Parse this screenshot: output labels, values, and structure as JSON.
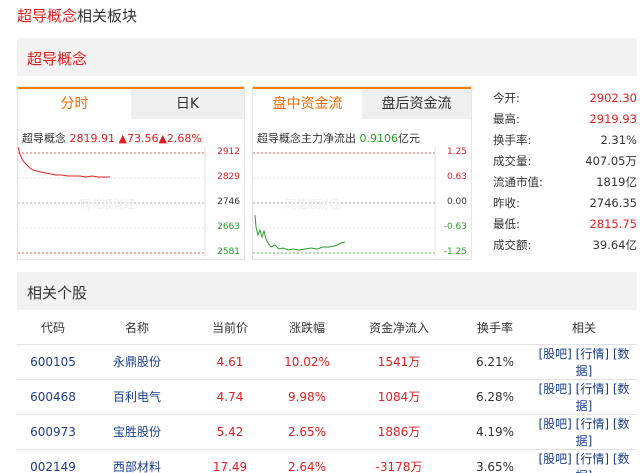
{
  "page_title": {
    "highlight": "超导概念",
    "suffix": "相关板块"
  },
  "board_name": "超导概念",
  "intraday_panel": {
    "tabs": [
      {
        "label": "分时",
        "active": true
      },
      {
        "label": "日K",
        "active": false
      }
    ],
    "caption_name": "超导概念",
    "caption_price": "2819.91",
    "caption_change": "▲73.56▲2.68%",
    "axis_labels": [
      "2912",
      "2829",
      "2746",
      "2663",
      "2581"
    ],
    "watermark": "同花顺财经",
    "line_color": "#e02020"
  },
  "flow_panel": {
    "tabs": [
      {
        "label": "盘中资金流",
        "active": true
      },
      {
        "label": "盘后资金流",
        "active": false
      }
    ],
    "caption_prefix": "超导概念主力净流出",
    "caption_value": "0.9106",
    "caption_unit": "亿元",
    "axis_labels": [
      "1.25",
      "0.63",
      "0.00",
      "-0.63",
      "-1.25"
    ],
    "watermark": "同花顺财经",
    "line_color": "#2a9d2a"
  },
  "stats": [
    {
      "label": "今开:",
      "value": "2902.30",
      "color": "red"
    },
    {
      "label": "最高:",
      "value": "2919.93",
      "color": "red"
    },
    {
      "label": "换手率:",
      "value": "2.31%",
      "color": "normal"
    },
    {
      "label": "成交量:",
      "value": "407.05万",
      "color": "normal"
    },
    {
      "label": "流通市值:",
      "value": "1819亿",
      "color": "normal"
    },
    {
      "label": "昨收:",
      "value": "2746.35",
      "color": "normal"
    },
    {
      "label": "最低:",
      "value": "2815.75",
      "color": "red"
    },
    {
      "label": "成交额:",
      "value": "39.64亿",
      "color": "normal"
    }
  ],
  "stocks_section_title": "相关个股",
  "table": {
    "headers": [
      "代码",
      "名称",
      "当前价",
      "涨跌幅",
      "资金净流入",
      "换手率",
      "相关"
    ],
    "rows": [
      {
        "code": "600105",
        "name": "永鼎股份",
        "price": "4.61",
        "change": "10.02%",
        "inflow": "1541万",
        "turnover": "6.21%"
      },
      {
        "code": "600468",
        "name": "百利电气",
        "price": "4.74",
        "change": "9.98%",
        "inflow": "1084万",
        "turnover": "6.28%"
      },
      {
        "code": "600973",
        "name": "宝胜股份",
        "price": "5.42",
        "change": "2.65%",
        "inflow": "1886万",
        "turnover": "4.19%"
      },
      {
        "code": "002149",
        "name": "西部材料",
        "price": "17.49",
        "change": "2.64%",
        "inflow": "-3178万",
        "turnover": "3.65%"
      }
    ],
    "links": [
      "[股吧]",
      "[行情]",
      "[数据]"
    ]
  }
}
